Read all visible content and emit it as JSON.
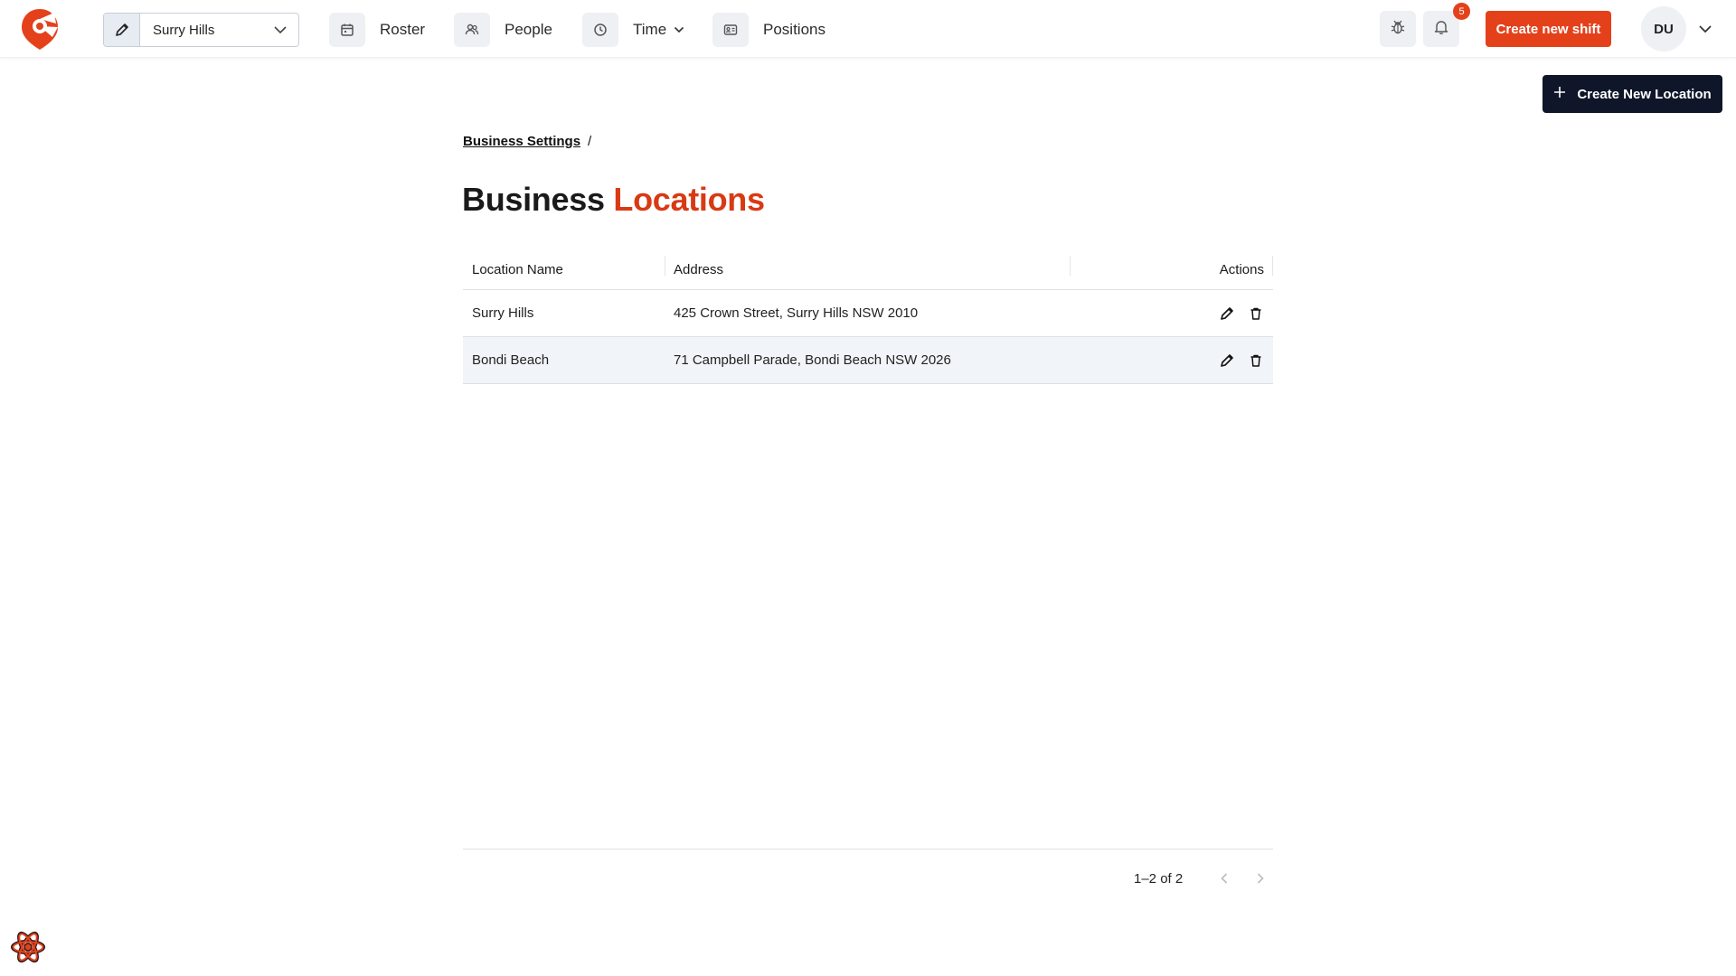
{
  "app": {
    "brand_color": "#e4411b",
    "dark_color": "#0f1629"
  },
  "header": {
    "location_select": {
      "value": "Surry Hills",
      "edit_icon": "pencil-icon",
      "chevron_icon": "chevron-down-icon"
    },
    "nav": [
      {
        "label": "Roster",
        "icon": "calendar-icon"
      },
      {
        "label": "People",
        "icon": "users-icon"
      },
      {
        "label": "Time",
        "icon": "clock-icon"
      },
      {
        "label": "Positions",
        "icon": "id-card-icon"
      }
    ],
    "notifications_count": "5",
    "create_shift_label": "Create new shift",
    "avatar_initials": "DU"
  },
  "page": {
    "create_location_label": "Create New Location",
    "breadcrumb": {
      "parent": "Business Settings",
      "separator": "/"
    },
    "title": {
      "part1": "Business",
      "part2": "Locations"
    }
  },
  "table": {
    "headers": {
      "name": "Location Name",
      "address": "Address",
      "actions": "Actions"
    },
    "rows": [
      {
        "name": "Surry Hills",
        "address": "425 Crown Street, Surry Hills NSW 2010"
      },
      {
        "name": "Bondi Beach",
        "address": "71 Campbell Parade, Bondi Beach NSW 2026"
      }
    ],
    "pagination": "1–2 of 2"
  }
}
